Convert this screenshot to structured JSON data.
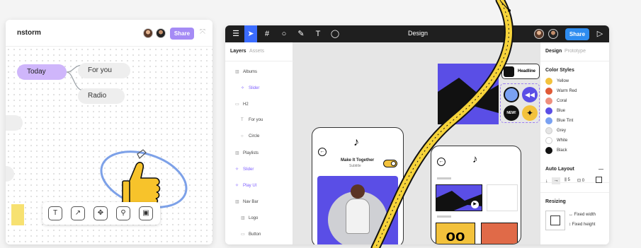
{
  "left": {
    "title": "nstorm",
    "share": "Share",
    "today": "Today",
    "for_you": "For you",
    "radio": "Radio",
    "tools": [
      "T",
      "↗",
      "✥",
      "⚲",
      "▣"
    ]
  },
  "right": {
    "title": "Design",
    "share": "Share",
    "tabs": {
      "layers": "Layers",
      "assets": "Assets",
      "design": "Design",
      "prototype": "Prototype"
    },
    "layers": [
      "Albums",
      "Slider",
      "H2",
      "For you",
      "Circle",
      "Playlists",
      "Slider",
      "Play UI",
      "Nav Bar",
      "Logo",
      "Button"
    ],
    "color_styles_title": "Color Styles",
    "colors": [
      {
        "name": "Yellow",
        "hex": "#f3c23c"
      },
      {
        "name": "Warm Red",
        "hex": "#e05a36"
      },
      {
        "name": "Coral",
        "hex": "#ee8f7d"
      },
      {
        "name": "Blue",
        "hex": "#5a4ee6"
      },
      {
        "name": "Blue Tint",
        "hex": "#7aa1f2"
      },
      {
        "name": "Grey",
        "hex": "#e5e5e5"
      },
      {
        "name": "White",
        "hex": "#ffffff"
      },
      {
        "name": "Black",
        "hex": "#111111"
      }
    ],
    "auto_layout": "Auto Layout",
    "auto_layout_minus": "—",
    "auto_spacing": "5",
    "auto_padding": "0",
    "resizing": "Resizing",
    "fixed_width": "Fixed width",
    "fixed_height": "Fixed height",
    "headline": "Headline",
    "new_badge": "NEW!",
    "make_it_together": "Make It Together",
    "subtitle": "Subtitle"
  }
}
